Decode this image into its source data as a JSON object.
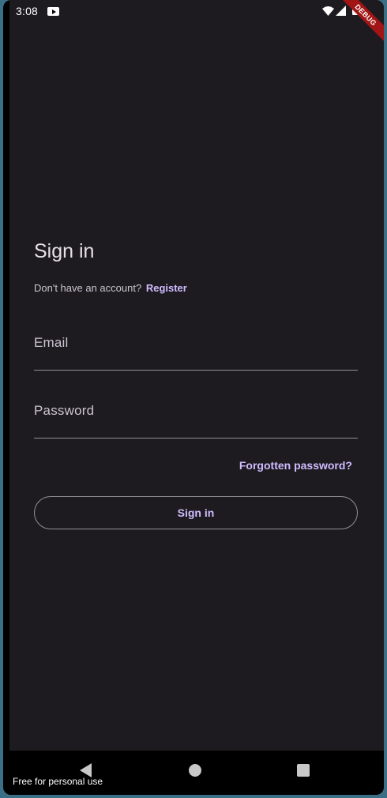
{
  "status_bar": {
    "time": "3:08",
    "icons": [
      "youtube-icon",
      "wifi-icon",
      "signal-icon",
      "battery-icon"
    ]
  },
  "debug_banner": "DEBUG",
  "signin": {
    "title": "Sign in",
    "no_account_text": "Don't have an account?",
    "register_link": "Register",
    "email_label": "Email",
    "password_label": "Password",
    "forgot_password": "Forgotten password?",
    "signin_button": "Sign in"
  },
  "nav_bar": {
    "icons": [
      "back-icon",
      "home-icon",
      "recents-icon"
    ]
  },
  "watermark": "Free for personal use",
  "colors": {
    "background": "#1d1b20",
    "accent": "#d0bcff",
    "outline": "#938f99",
    "text": "#e6e1e5"
  }
}
